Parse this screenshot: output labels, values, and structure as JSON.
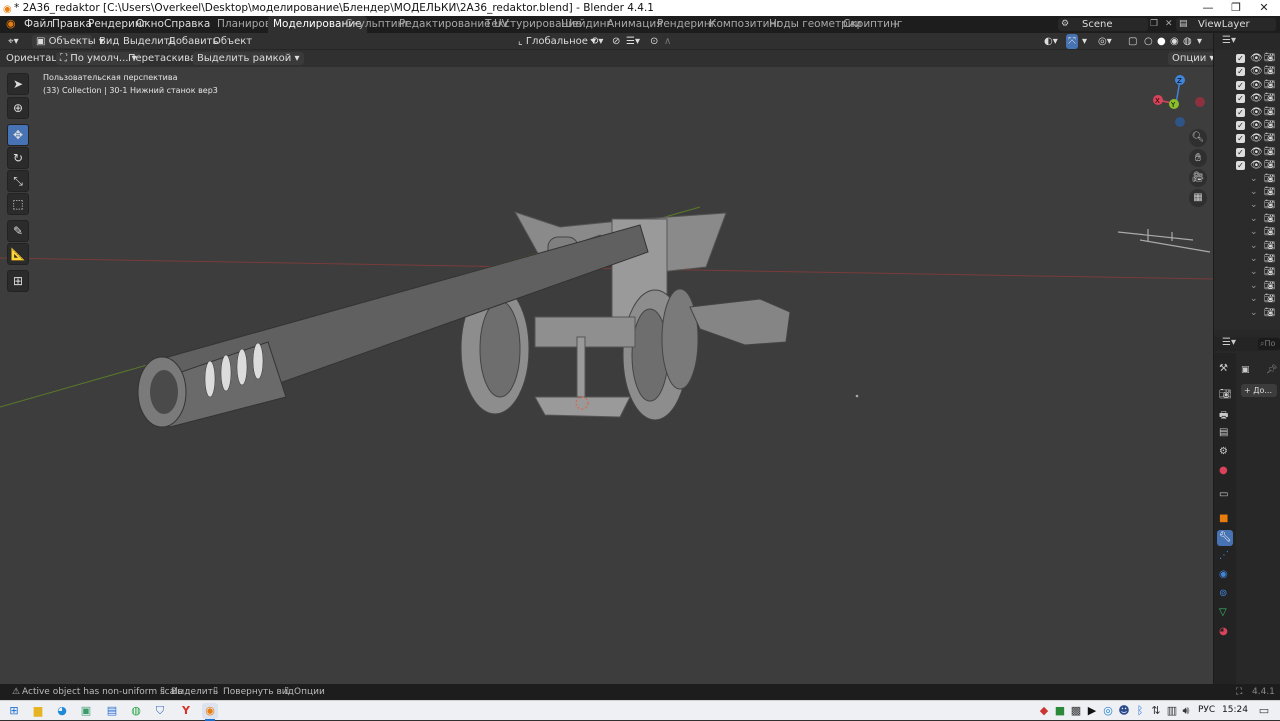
{
  "window": {
    "title": "* 2A36_redaktor [C:\\Users\\Overkeel\\Desktop\\моделирование\\Блендер\\МОДЕЛЬКИ\\2A36_redaktor.blend] - Blender 4.4.1",
    "controls": [
      "—",
      "❐",
      "✕"
    ]
  },
  "menu": [
    "Файл",
    "Правка",
    "Рендеринг",
    "Окно",
    "Справка"
  ],
  "workspaces": [
    "Планировка",
    "Моделирование",
    "Скульптинг",
    "Редактирование UV",
    "Текстурирование",
    "Шейдинг",
    "Анимация",
    "Рендеринг",
    "Композитинг",
    "Ноды геометрии",
    "Скриптинг"
  ],
  "active_workspace": "Моделирование",
  "scene": {
    "label": "Scene",
    "view_layer": "ViewLayer"
  },
  "header": {
    "mode": "Объекты",
    "menus": [
      "Вид",
      "Выделить",
      "Добавить",
      "Объект"
    ],
    "transform": "Глобальное"
  },
  "header2": {
    "orientation_label": "Ориентация:",
    "orientation_value": "По умолч...",
    "drag_label": "Перетаскивание:",
    "drag_value": "Выделить рамкой",
    "options": "Опции"
  },
  "viewport": {
    "line1": "Пользовательская перспектива",
    "line2": "(33) Collection | 30-1 Нижний станок вер3",
    "gizmo": {
      "x": "X",
      "y": "Y",
      "z": "Z"
    }
  },
  "properties": {
    "search_placeholder": "По",
    "add_button": "+ До..."
  },
  "status": {
    "warning": "Active object has non-uniform scale",
    "select": "Выделить",
    "rotate": "Повернуть вид",
    "options": "Опции",
    "version": "4.4.1"
  },
  "taskbar": {
    "lang": "РУС",
    "time": "15:24"
  },
  "colors": {
    "accent": "#4772b3",
    "x_axis": "#d9435a",
    "y_axis": "#8cbe2b",
    "z_axis": "#3f84d9"
  }
}
